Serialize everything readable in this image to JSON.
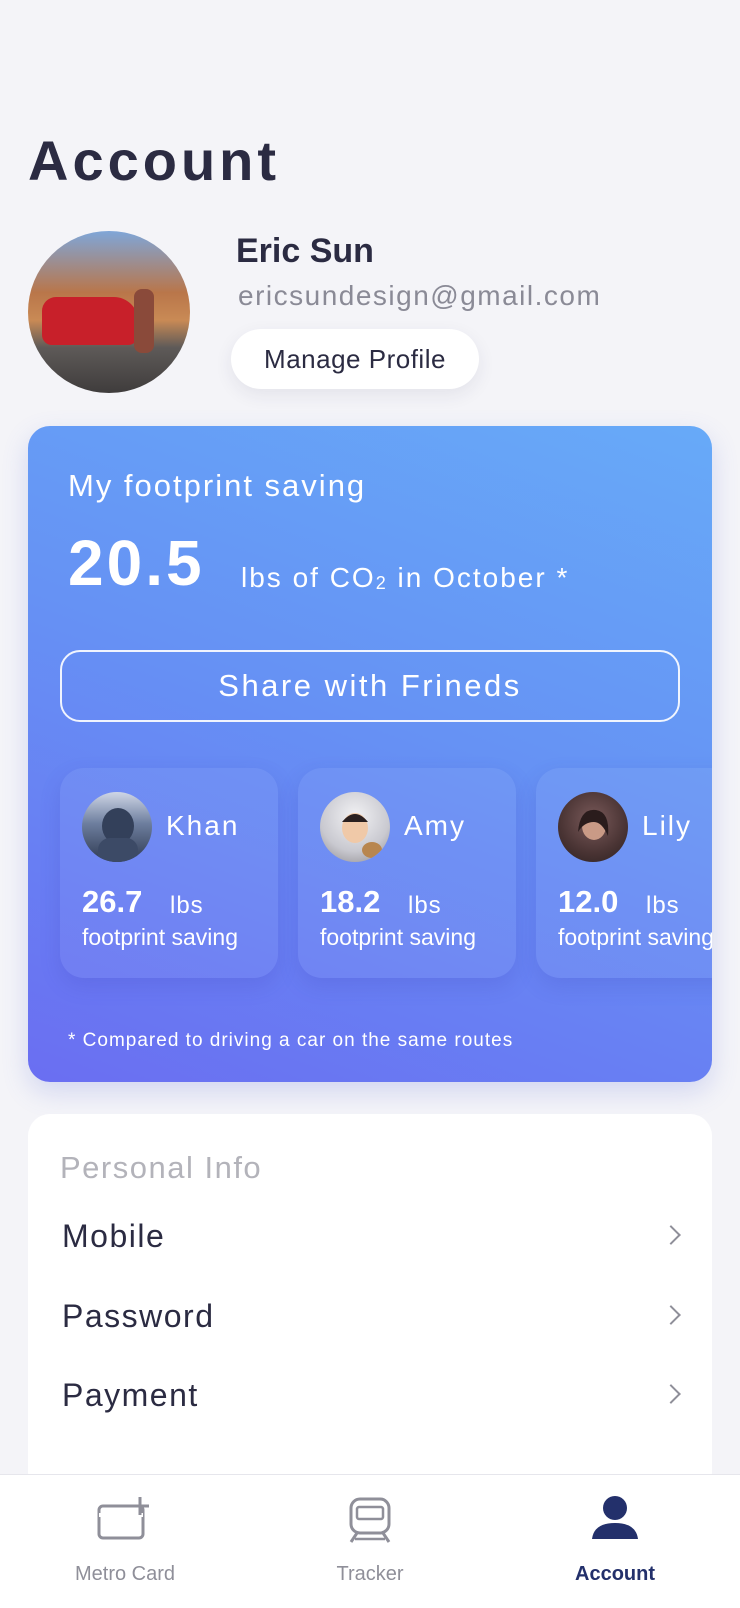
{
  "page": {
    "title": "Account"
  },
  "profile": {
    "name": "Eric Sun",
    "email": "ericsundesign@gmail.com",
    "manage_label": "Manage Profile"
  },
  "saving": {
    "title": "My footprint saving",
    "value": "20.5",
    "unit_prefix": "lbs of CO",
    "unit_sub": "2",
    "unit_suffix": " in October *",
    "share_label": "Share with Frineds",
    "footnote": "* Compared to driving a car on the same routes",
    "friends": [
      {
        "name": "Khan",
        "value": "26.7",
        "unit": "lbs",
        "caption": "footprint saving"
      },
      {
        "name": "Amy",
        "value": "18.2",
        "unit": "lbs",
        "caption": "footprint saving"
      },
      {
        "name": "Lily",
        "value": "12.0",
        "unit": "lbs",
        "caption": "footprint saving"
      }
    ]
  },
  "personal_info": {
    "heading": "Personal Info",
    "items": [
      {
        "label": "Mobile"
      },
      {
        "label": "Password"
      },
      {
        "label": "Payment"
      }
    ]
  },
  "tabs": [
    {
      "label": "Metro Card",
      "icon": "metro-card-icon",
      "active": false
    },
    {
      "label": "Tracker",
      "icon": "train-icon",
      "active": false
    },
    {
      "label": "Account",
      "icon": "person-icon",
      "active": true
    }
  ],
  "colors": {
    "accent": "#23306b",
    "card_gradient_start": "#67aaf8",
    "card_gradient_end": "#6a6ef2",
    "background": "#f4f4f8"
  }
}
